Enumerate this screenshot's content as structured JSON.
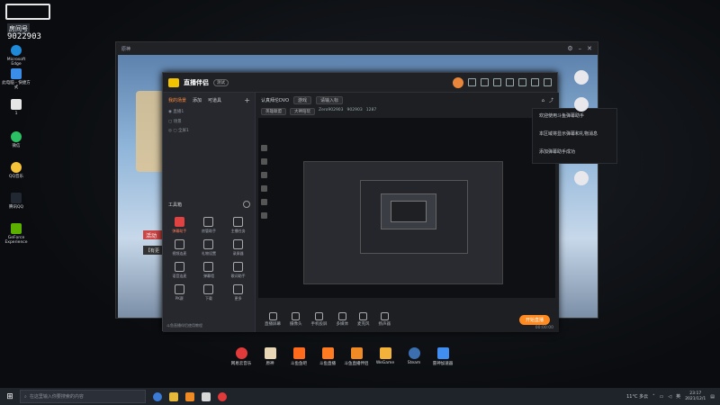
{
  "watermark": {
    "line1": "斗鱼",
    "label": "房间号",
    "number": "9022903"
  },
  "desktop_icons": [
    {
      "label": "Microsoft Edge",
      "color": "#1f8ad8"
    },
    {
      "label": "此电脑 - 快捷方式",
      "color": "#3b8ee8"
    },
    {
      "label": "1",
      "color": "#e6e6e6"
    },
    {
      "label": "微信",
      "color": "#2ac063"
    },
    {
      "label": "QQ音乐",
      "color": "#f4c33a"
    },
    {
      "label": "腾讯QQ",
      "color": "#222831"
    },
    {
      "label": "GeForce Experience",
      "color": "#5cb000"
    }
  ],
  "game_window": {
    "title": "原神"
  },
  "scene_hud": {
    "activity": "活动",
    "tag": "【有更"
  },
  "app": {
    "brand": "直播伴侣",
    "version_badge": "测试",
    "tabs": [
      "我的场景",
      "添加",
      "可道具"
    ],
    "scenes": [
      "直播1",
      "场景",
      "全屏1"
    ],
    "live_title": "认真拜伦DVO",
    "live_tag": "游戏",
    "live_hint": "请输入标",
    "meta": [
      "英雄联盟",
      "大神陪玩",
      "Zero902903",
      "902903",
      "1287"
    ],
    "toolbox_title": "工具箱",
    "tools": [
      {
        "label": "弹幕助手",
        "hot": true
      },
      {
        "label": "房管助手",
        "hot": false
      },
      {
        "label": "主播任务",
        "hot": false
      },
      {
        "label": "视频连麦",
        "hot": false
      },
      {
        "label": "礼物设置",
        "hot": false
      },
      {
        "label": "录屏器",
        "hot": false
      },
      {
        "label": "语音连麦",
        "hot": false
      },
      {
        "label": "弹幕墙",
        "hot": false
      },
      {
        "label": "歌词助手",
        "hot": false
      },
      {
        "label": "PK赛",
        "hot": false
      },
      {
        "label": "下载",
        "hot": false
      },
      {
        "label": "更多",
        "hot": false
      }
    ],
    "bottom_hint": "斗鱼直播伴侣使用教程",
    "controls": [
      "直播屏幕",
      "摄像头",
      "手机投屏",
      "多媒体",
      "麦克风",
      "扬声器"
    ],
    "go_live": "开始直播",
    "time": "00:00:00"
  },
  "side_menu": [
    "欢迎使用斗鱼弹幕助手",
    "本区域将显示弹幕和礼物消息",
    "添加弹幕助手成功"
  ],
  "dock_icons": [
    {
      "label": "网易云音乐",
      "color": "#e03a3a"
    },
    {
      "label": "原神",
      "color": "#e8d6b4"
    },
    {
      "label": "斗鱼鱼吧",
      "color": "#ff6b1a"
    },
    {
      "label": "斗鱼直播",
      "color": "#ff7b22"
    },
    {
      "label": "斗鱼直播伴侣",
      "color": "#f08a24"
    },
    {
      "label": "WeGame",
      "color": "#f3b23a"
    },
    {
      "label": "Steam",
      "color": "#3c6fb0"
    },
    {
      "label": "雷神加速器",
      "color": "#3f8ef0"
    }
  ],
  "taskbar": {
    "search_placeholder": "在这里输入你要搜索的内容",
    "weather": "11°C 多云",
    "lang": "英",
    "time": "23:17",
    "date": "2021/12/1"
  }
}
